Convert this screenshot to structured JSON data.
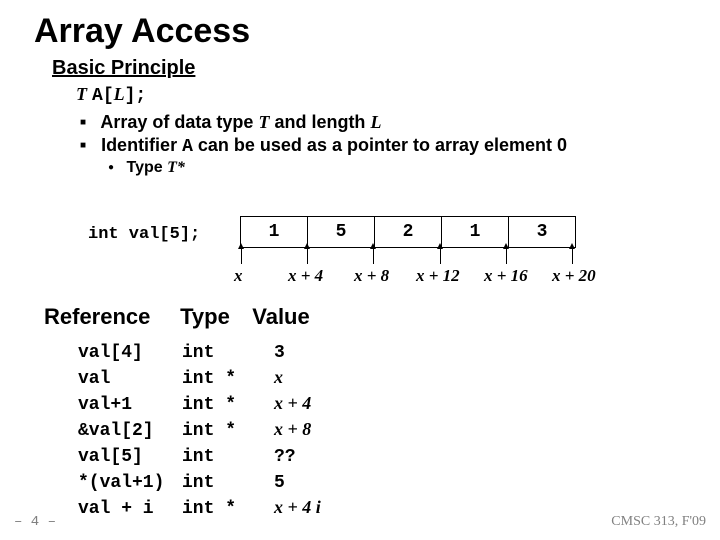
{
  "title": "Array Access",
  "subtitle": "Basic Principle",
  "decl": {
    "t": "T",
    "a": "A[",
    "l": "L",
    "end": "];"
  },
  "bullets": {
    "b1": {
      "pre": "Array of data type ",
      "t": "T",
      "mid": " and length ",
      "l": "L"
    },
    "b2": {
      "pre": "Identifier ",
      "a": "A",
      "post": " can be used as a pointer to array element 0"
    }
  },
  "subbullet": {
    "pre": "Type ",
    "t": "T*"
  },
  "arraydecl": "int val[5];",
  "cells": {
    "c0": "1",
    "c1": "5",
    "c2": "2",
    "c3": "1",
    "c4": "3"
  },
  "captions": {
    "x0": "x",
    "x1": "x + 4",
    "x2": "x + 8",
    "x3": "x + 12",
    "x4": "x + 16",
    "x5": "x + 20"
  },
  "section": {
    "ref": "Reference",
    "type": "Type",
    "val": "Value"
  },
  "rows": {
    "r0": {
      "ref": "val[4]",
      "type": "int",
      "val": "3"
    },
    "r1": {
      "ref": "val",
      "type": "int *",
      "val": "x"
    },
    "r2": {
      "ref": "val+1",
      "type": "int *",
      "val": "x + 4"
    },
    "r3": {
      "ref": "&val[2]",
      "type": "int *",
      "val": "x + 8"
    },
    "r4": {
      "ref": "val[5]",
      "type": "int",
      "val": "??"
    },
    "r5": {
      "ref": "*(val+1)",
      "type": "int",
      "val": "5"
    },
    "r6": {
      "ref": "val + i",
      "type": "int *",
      "val": "x + 4 i"
    }
  },
  "pagenum": "– 4 –",
  "footer": "CMSC 313, F'09",
  "chart_data": {
    "type": "table",
    "array_decl": "int val[5];",
    "array_contents": [
      1,
      5,
      2,
      1,
      3
    ],
    "addresses": [
      "x",
      "x+4",
      "x+8",
      "x+12",
      "x+16",
      "x+20"
    ],
    "table": [
      {
        "reference": "val[4]",
        "type": "int",
        "value": "3"
      },
      {
        "reference": "val",
        "type": "int *",
        "value": "x"
      },
      {
        "reference": "val+1",
        "type": "int *",
        "value": "x + 4"
      },
      {
        "reference": "&val[2]",
        "type": "int *",
        "value": "x + 8"
      },
      {
        "reference": "val[5]",
        "type": "int",
        "value": "??"
      },
      {
        "reference": "*(val+1)",
        "type": "int",
        "value": "5"
      },
      {
        "reference": "val + i",
        "type": "int *",
        "value": "x + 4 i"
      }
    ]
  }
}
